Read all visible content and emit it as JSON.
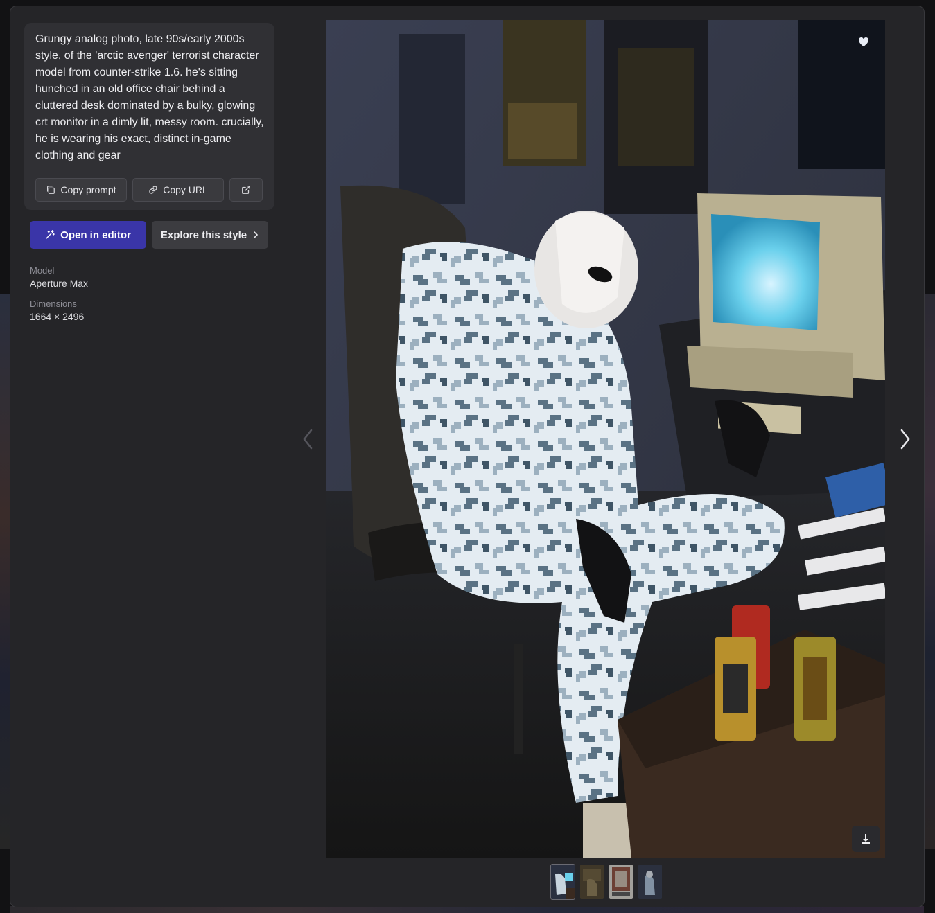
{
  "prompt": {
    "text": "Grungy analog photo, late 90s/early 2000s style, of the 'arctic avenger' terrorist character model from counter-strike 1.6. he's sitting hunched in an old office chair behind a cluttered desk dominated by a bulky, glowing crt monitor in a dimly lit, messy room. crucially, he is wearing his exact, distinct in-game clothing and gear",
    "copy_prompt_label": "Copy prompt",
    "copy_url_label": "Copy URL"
  },
  "actions": {
    "open_editor_label": "Open in editor",
    "explore_style_label": "Explore this style"
  },
  "meta": {
    "model_label": "Model",
    "model_value": "Aperture Max",
    "dimensions_label": "Dimensions",
    "dimensions_value": "1664 × 2496"
  },
  "thumbnails": [
    "thumb-1",
    "thumb-2",
    "thumb-3",
    "thumb-4"
  ],
  "active_thumbnail": 0,
  "colors": {
    "accent": "#3a35a8",
    "panel": "#252528",
    "card": "#303034"
  }
}
